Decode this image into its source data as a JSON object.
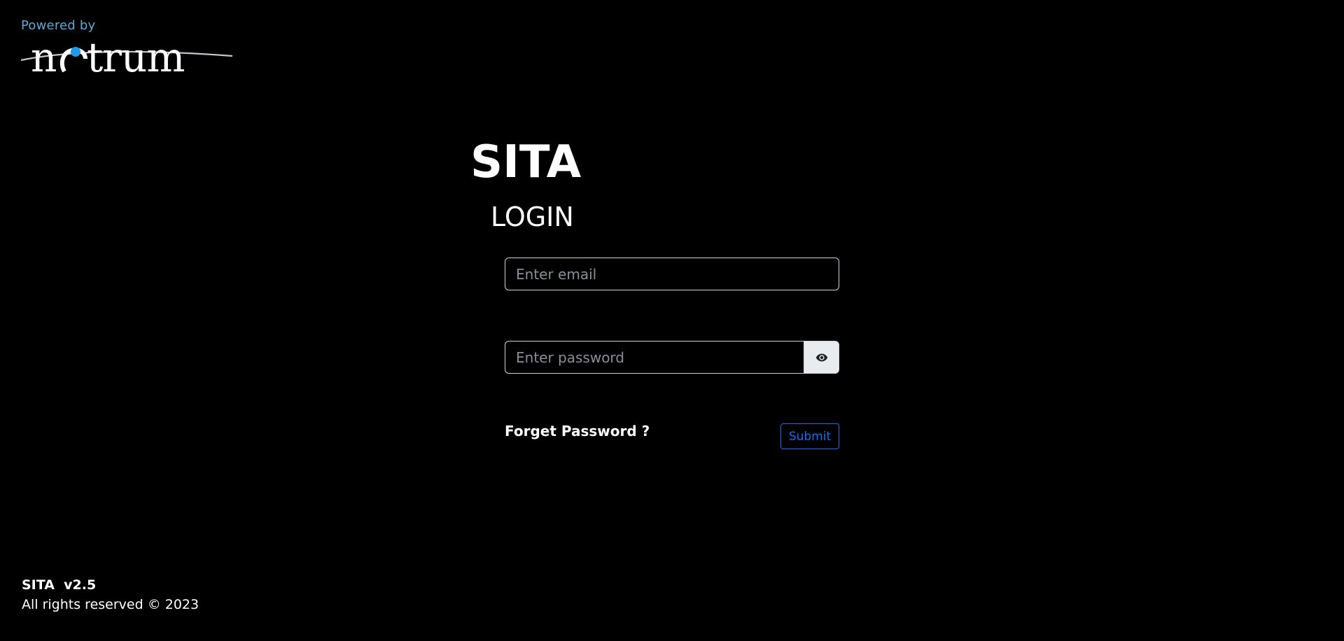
{
  "branding": {
    "powered_by": "Powered by",
    "logo_name": "netrum",
    "logo_text_prefix": "n",
    "logo_text_suffix": "trum",
    "powered_by_color": "#5aa9d6",
    "logo_accent_color": "#1e9be8"
  },
  "header": {
    "app_title": "SITA",
    "form_title": "LOGIN"
  },
  "form": {
    "email_placeholder": "Enter email",
    "email_value": "",
    "password_placeholder": "Enter password",
    "password_value": "",
    "toggle_icon": "eye-icon",
    "forget_password": "Forget Password ?",
    "submit": "Submit",
    "submit_color": "#0d6efd"
  },
  "footer": {
    "version": "SITA  v2.5",
    "copyright": "All rights reserved © 2023"
  }
}
